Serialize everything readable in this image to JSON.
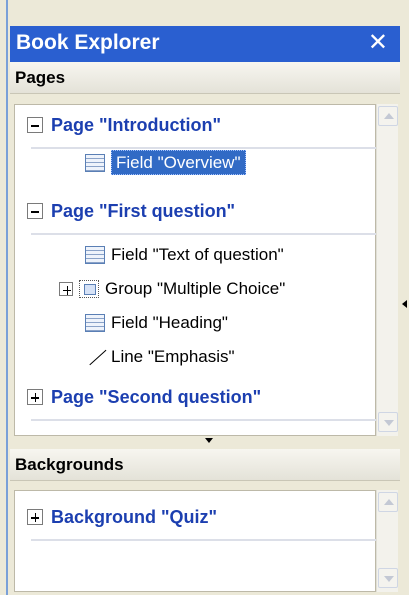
{
  "window": {
    "title": "Book Explorer",
    "close_glyph": "✕"
  },
  "pages_section": {
    "header": "Pages",
    "pages": [
      {
        "label": "Page \"Introduction\"",
        "expanded": true,
        "children": [
          {
            "type": "field",
            "label": "Field \"Overview\"",
            "selected": true
          }
        ]
      },
      {
        "label": "Page \"First question\"",
        "expanded": true,
        "children": [
          {
            "type": "field",
            "label": "Field \"Text of question\""
          },
          {
            "type": "group",
            "label": "Group \"Multiple Choice\"",
            "expandable": true
          },
          {
            "type": "field",
            "label": "Field \"Heading\""
          },
          {
            "type": "line",
            "label": "Line \"Emphasis\""
          }
        ]
      },
      {
        "label": "Page \"Second question\"",
        "expanded": false,
        "children": []
      }
    ]
  },
  "backgrounds_section": {
    "header": "Backgrounds",
    "items": [
      {
        "label": "Background \"Quiz\"",
        "expanded": false
      }
    ]
  },
  "colors": {
    "titlebar": "#2a5fd0",
    "page_text": "#1c3fb0",
    "selection": "#316ac5"
  }
}
